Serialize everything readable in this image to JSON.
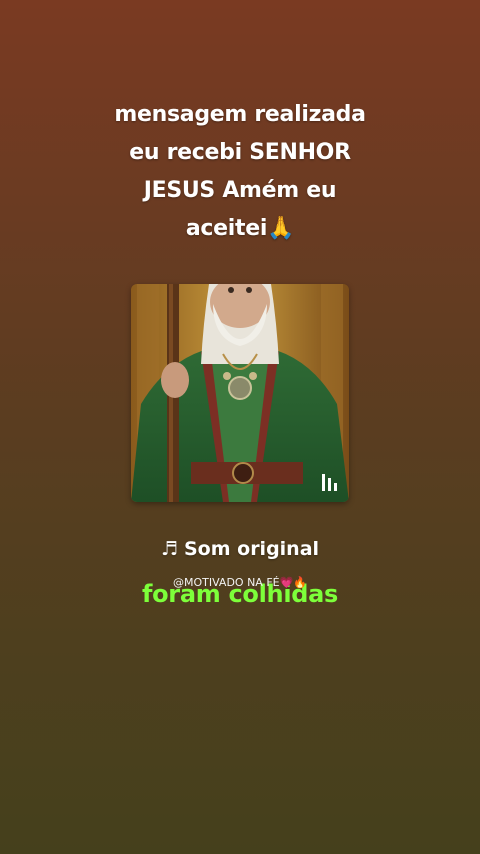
{
  "message": {
    "line1": "mensagem realizada",
    "line2": "eu recebi SENHOR",
    "line3": "JESUS Amém eu",
    "line4": "aceitei🙏"
  },
  "audio": {
    "note_icon": "music-note-icon",
    "note_glyph": "♬",
    "label": "Som original"
  },
  "channel": {
    "handle": "@MOTIVADO NA FÉ",
    "hearts": "💗🔥"
  },
  "caption": "foram colhidas",
  "cover": {
    "icon": "sound-bars-icon",
    "alt": "elderly bearded man with staff in green robe"
  },
  "colors": {
    "caption": "#7dff3a",
    "background_top": "#7a3a22",
    "background_bottom": "#45401c"
  }
}
